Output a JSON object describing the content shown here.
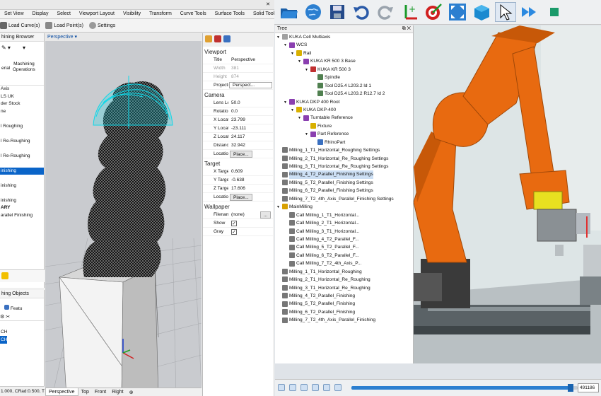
{
  "left_app": {
    "menu_items": [
      "Set View",
      "Display",
      "Select",
      "Viewport Layout",
      "Visibility",
      "Transform",
      "Curve Tools",
      "Surface Tools",
      "Solid Tool"
    ],
    "tool_buttons": [
      "Load Curve(s)",
      "Load Point(s)",
      "Settings"
    ],
    "machining_browser": {
      "title": "hining Browser",
      "tab_labels": [
        "erial",
        "Machining\nOperations"
      ],
      "items": [
        "Axis",
        "LS UK",
        "der Stock",
        "ne",
        "",
        "l Roughing",
        "",
        "l Re-Roughing",
        "",
        "l Re-Roughing",
        "",
        "inishing",
        "",
        "inishing",
        "",
        "inishing",
        "ARY",
        "arallel Finishing"
      ],
      "selected_index": 11
    },
    "machining_objects": {
      "title": "hing Objects",
      "feature_label": "Featu",
      "items": [
        "CH",
        "CH"
      ],
      "selected_index": 1
    },
    "status_text": "1.000, CRad:0.500, T",
    "viewport": {
      "title": "Perspective",
      "tabs": [
        "Perspective",
        "Top",
        "Front",
        "Right"
      ],
      "active_tab": 0
    }
  },
  "properties": {
    "viewport_section": "Viewport",
    "title_label": "Title",
    "title_value": "Perspective",
    "width_label": "Width",
    "width_value": "381",
    "height_label": "Height",
    "height_value": "874",
    "projection_label": "Projection",
    "projection_value": "Perspect...",
    "camera_section": "Camera",
    "lens_label": "Lens Len...",
    "lens_value": "50.0",
    "rotation_label": "Rotation",
    "rotation_value": "0.0",
    "xloc_label": "X Location",
    "xloc_value": "23.799",
    "yloc_label": "Y Location",
    "yloc_value": "-23.111",
    "zloc_label": "Z Location",
    "zloc_value": "24.117",
    "distance_label": "Distance ...",
    "distance_value": "32.942",
    "location_label": "Location",
    "place_button": "Place...",
    "target_section": "Target",
    "xtgt_label": "X Target",
    "xtgt_value": "0.609",
    "ytgt_label": "Y Target",
    "ytgt_value": "-0.638",
    "ztgt_label": "Z Target",
    "ztgt_value": "17.606",
    "tlocation_label": "Location",
    "tplace_button": "Place...",
    "wallpaper_section": "Wallpaper",
    "filename_label": "Filename",
    "filename_value": "(none)",
    "browse_button": "...",
    "show_label": "Show",
    "show_checked": "✓",
    "gray_label": "Gray",
    "gray_checked": "✓"
  },
  "tree": {
    "title": "Tree",
    "header_controls": "⧉ ✕",
    "nodes": [
      {
        "label": "KUKA Cell Multiaxis",
        "depth": 0,
        "color": "#a0a0a0",
        "exp": "▼"
      },
      {
        "label": "WCS",
        "depth": 1,
        "color": "#8a3fb0",
        "exp": "▼"
      },
      {
        "label": "Rail",
        "depth": 2,
        "color": "#d8b000",
        "exp": "▼"
      },
      {
        "label": "KUKA KR 500 3 Base",
        "depth": 3,
        "color": "#8a3fb0",
        "exp": "▼"
      },
      {
        "label": "KUKA KR 500 3",
        "depth": 4,
        "color": "#c03030",
        "exp": "▼"
      },
      {
        "label": "Spindle",
        "depth": 5,
        "color": "#508050",
        "exp": ""
      },
      {
        "label": "Tool D25.4 L203.2 ld 1",
        "depth": 5,
        "color": "#508050",
        "exp": ""
      },
      {
        "label": "Tool D25.4 L203.2 R12.7 ld 2",
        "depth": 5,
        "color": "#508050",
        "exp": ""
      },
      {
        "label": "KUKA DKP 400 Root",
        "depth": 1,
        "color": "#8a3fb0",
        "exp": "▼"
      },
      {
        "label": "KUKA DKP-400",
        "depth": 2,
        "color": "#d8b000",
        "exp": "▼"
      },
      {
        "label": "Turntable Reference",
        "depth": 3,
        "color": "#8a3fb0",
        "exp": "▼"
      },
      {
        "label": "Fixture",
        "depth": 4,
        "color": "#d8b000",
        "exp": ""
      },
      {
        "label": "Part Reference",
        "depth": 4,
        "color": "#8a3fb0",
        "exp": "▼"
      },
      {
        "label": "RhinoPart",
        "depth": 5,
        "color": "#3a70c0",
        "exp": ""
      },
      {
        "label": "Milling_1_T1_Horizontal_Roughing Settings",
        "depth": 0,
        "color": "#777",
        "exp": ""
      },
      {
        "label": "Milling_2_T1_Horizontal_Re_Roughing Settings",
        "depth": 0,
        "color": "#777",
        "exp": ""
      },
      {
        "label": "Milling_3_T1_Horizontal_Re_Roughing Settings",
        "depth": 0,
        "color": "#777",
        "exp": ""
      },
      {
        "label": "Milling_4_T2_Parallel_Finishing Settings",
        "depth": 0,
        "color": "#777",
        "exp": "",
        "hl": true
      },
      {
        "label": "Milling_5_T2_Parallel_Finishing Settings",
        "depth": 0,
        "color": "#777",
        "exp": ""
      },
      {
        "label": "Milling_6_T2_Parallel_Finishing Settings",
        "depth": 0,
        "color": "#777",
        "exp": ""
      },
      {
        "label": "Milling_7_T2_4th_Axis_Parallel_Finishing Settings",
        "depth": 0,
        "color": "#777",
        "exp": ""
      },
      {
        "label": "MainMilling",
        "depth": 0,
        "color": "#d8a000",
        "exp": "▼"
      },
      {
        "label": "Call Milling_1_T1_Horizontal...",
        "depth": 1,
        "color": "#777",
        "exp": ""
      },
      {
        "label": "Call Milling_2_T1_Horizontal...",
        "depth": 1,
        "color": "#777",
        "exp": ""
      },
      {
        "label": "Call Milling_3_T1_Horizontal...",
        "depth": 1,
        "color": "#777",
        "exp": ""
      },
      {
        "label": "Call Milling_4_T2_Parallel_F...",
        "depth": 1,
        "color": "#777",
        "exp": ""
      },
      {
        "label": "Call Milling_5_T2_Parallel_F...",
        "depth": 1,
        "color": "#777",
        "exp": ""
      },
      {
        "label": "Call Milling_6_T2_Parallel_F...",
        "depth": 1,
        "color": "#777",
        "exp": ""
      },
      {
        "label": "Call Milling_7_T2_4th_Axis_P...",
        "depth": 1,
        "color": "#777",
        "exp": ""
      },
      {
        "label": "Milling_1_T1_Horizontal_Roughing",
        "depth": 0,
        "color": "#777",
        "exp": ""
      },
      {
        "label": "Milling_2_T1_Horizontal_Re_Roughing",
        "depth": 0,
        "color": "#777",
        "exp": ""
      },
      {
        "label": "Milling_3_T1_Horizontal_Re_Roughing",
        "depth": 0,
        "color": "#777",
        "exp": ""
      },
      {
        "label": "Milling_4_T2_Parallel_Finishing",
        "depth": 0,
        "color": "#777",
        "exp": ""
      },
      {
        "label": "Milling_5_T2_Parallel_Finishing",
        "depth": 0,
        "color": "#777",
        "exp": ""
      },
      {
        "label": "Milling_6_T2_Parallel_Finishing",
        "depth": 0,
        "color": "#777",
        "exp": ""
      },
      {
        "label": "Milling_7_T2_4th_Axis_Parallel_Finishing",
        "depth": 0,
        "color": "#777",
        "exp": ""
      }
    ]
  },
  "right_toolbar": {
    "icons": [
      "open-folder-icon",
      "globe-icon",
      "save-icon",
      "undo-icon",
      "redo-icon",
      "add-axis-icon",
      "target-icon",
      "fit-view-icon",
      "cube-view-icon",
      "pointer-icon",
      "play-forward-icon",
      "stop-icon"
    ]
  },
  "player": {
    "frame_value": "491186",
    "progress_fraction": 0.97
  },
  "colors": {
    "robot_orange": "#e86a10",
    "selection_blue": "#0a64c8",
    "toolpath_cyan": "#10d8e8"
  }
}
